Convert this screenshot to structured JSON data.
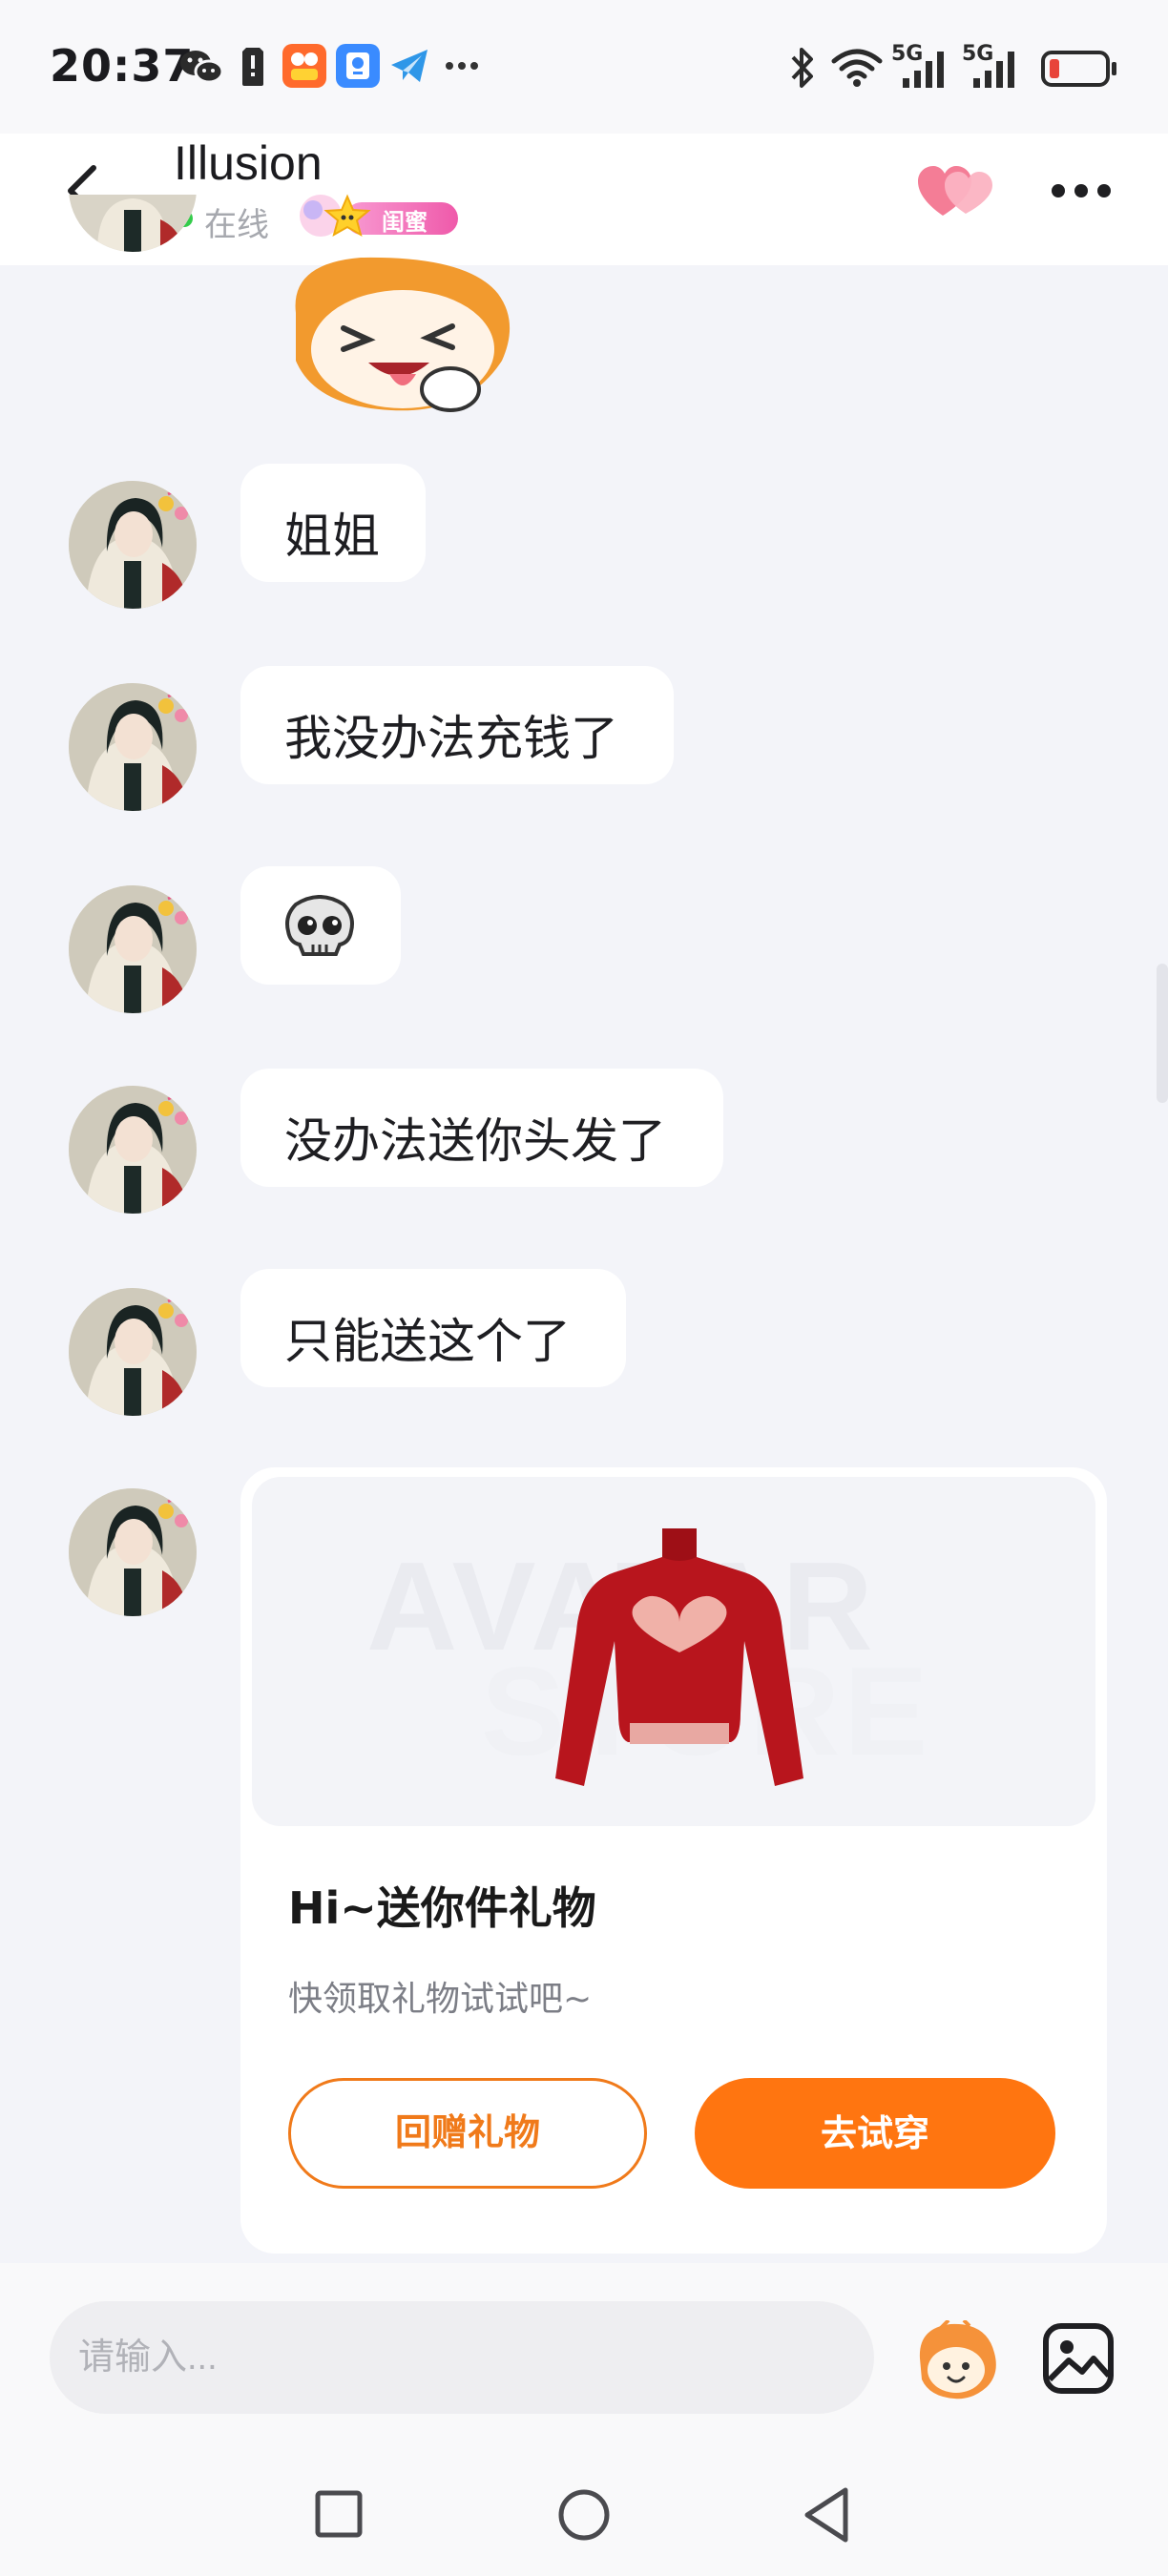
{
  "status_bar": {
    "time": "20:37",
    "left_icons": [
      "wechat-icon",
      "sim-card-icon",
      "app-icon-orange",
      "app-icon-blue",
      "telegram-icon",
      "more-dots-icon"
    ],
    "right_icons": [
      "bluetooth-icon",
      "wifi-icon",
      "signal-5g-icon",
      "signal-5g-icon",
      "battery-low-icon"
    ],
    "network_label_1": "5G",
    "network_label_2": "5G"
  },
  "header": {
    "contact_name": "Illusion",
    "status": "在线",
    "relationship": "闺蜜"
  },
  "messages": [
    {
      "type": "text",
      "text": "姐姐"
    },
    {
      "type": "text",
      "text": "我没办法充钱了"
    },
    {
      "type": "emoji",
      "icon": "skull-emoji-icon"
    },
    {
      "type": "text",
      "text": "没办法送你头发了"
    },
    {
      "type": "text",
      "text": "只能送这个了"
    }
  ],
  "gift_card": {
    "watermark_line1": "AVATAR",
    "watermark_line2": "STORE",
    "title": "Hi~送你件礼物",
    "subtitle": "快领取礼物试试吧~",
    "return_gift_label": "回赠礼物",
    "try_on_label": "去试穿"
  },
  "input": {
    "placeholder": "请输入..."
  },
  "colors": {
    "accent": "#ff7510",
    "chat_background": "#f3f4f9",
    "bubble": "#ffffff",
    "online": "#33cc4a",
    "relationship_badge": "#ef5aaa",
    "heart": "#f58aa0"
  }
}
